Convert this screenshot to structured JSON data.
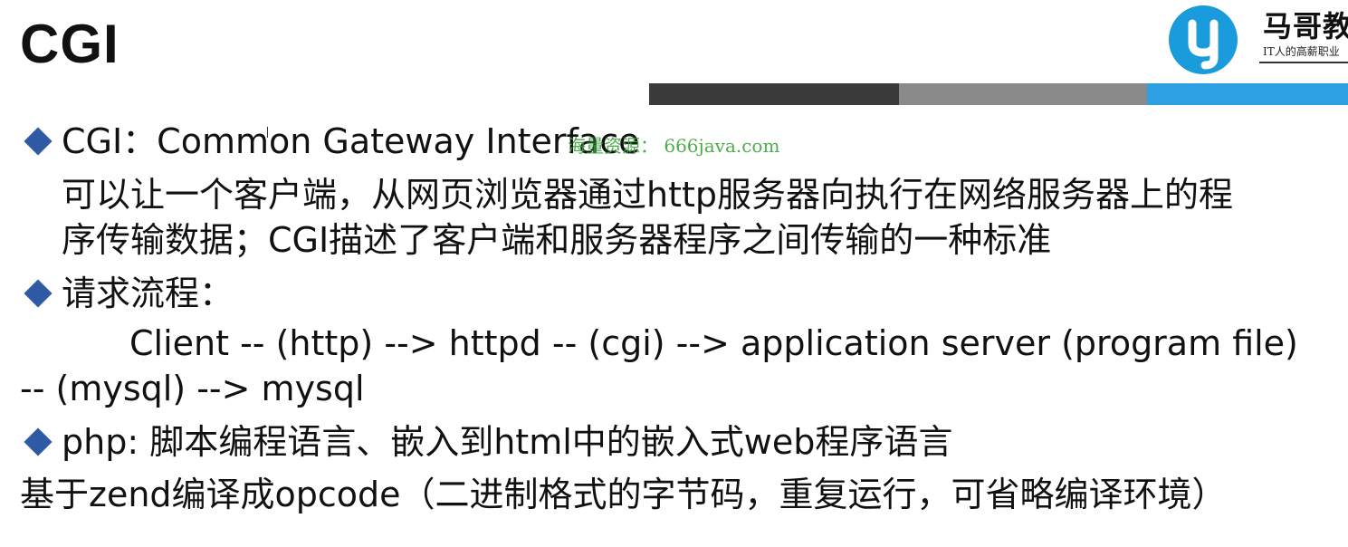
{
  "slide": {
    "title": "CGI",
    "logo": {
      "name": "马哥教",
      "slogan": "IT人的高薪职业",
      "color": "#1a9bdc"
    },
    "header_bar_colors": [
      "#3a3a3a",
      "#8a8a8a",
      "#2d9fe3"
    ],
    "bullet_color": "#2e5aa3",
    "watermark": "海量资源： 666java.com",
    "lines": {
      "cgi_definition": "CGI：Common Gateway Interface",
      "cgi_desc_1": "可以让一个客户端，从网页浏览器通过http服务器向执行在网络服务器上的程",
      "cgi_desc_2": "序传输数据；CGI描述了客户端和服务器程序之间传输的一种标准",
      "flow_heading": "请求流程：",
      "flow_1": "Client -- (http) --> httpd -- (cgi) --> application server (program file)",
      "flow_2": "-- (mysql) --> mysql",
      "php": "php: 脚本编程语言、嵌入到html中的嵌入式web程序语言",
      "zend": "基于zend编译成opcode（二进制格式的字节码，重复运行，可省略编译环境）"
    }
  }
}
